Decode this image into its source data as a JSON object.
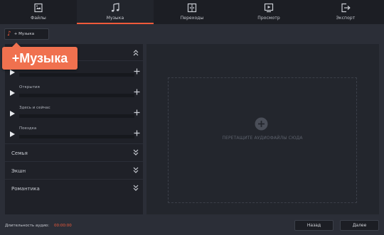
{
  "tabs": [
    {
      "label": "Файлы",
      "icon": "files-icon"
    },
    {
      "label": "Музыка",
      "icon": "music-icon"
    },
    {
      "label": "Переходы",
      "icon": "transitions-icon"
    },
    {
      "label": "Просмотр",
      "icon": "preview-icon"
    },
    {
      "label": "Экспорт",
      "icon": "export-icon"
    }
  ],
  "active_tab": "Музыка",
  "add_music_label": "+ Музыка",
  "callout_label": "+Музыка",
  "tracks": [
    {
      "name": ""
    },
    {
      "name": "Открытия"
    },
    {
      "name": "Здесь и сейчас"
    },
    {
      "name": "Поездка"
    }
  ],
  "categories": [
    {
      "label": "Семья"
    },
    {
      "label": "Экшн"
    },
    {
      "label": "Романтика"
    }
  ],
  "drop_text": "ПЕРЕТАЩИТЕ АУДИОФАЙЛЫ СЮДА",
  "duration_label": "Длительность аудио:",
  "duration_value": "00:00:00",
  "back_label": "Назад",
  "next_label": "Далее",
  "colors": {
    "accent": "#f05a3a",
    "panel": "#1f2128",
    "bg": "#2b2e37"
  }
}
